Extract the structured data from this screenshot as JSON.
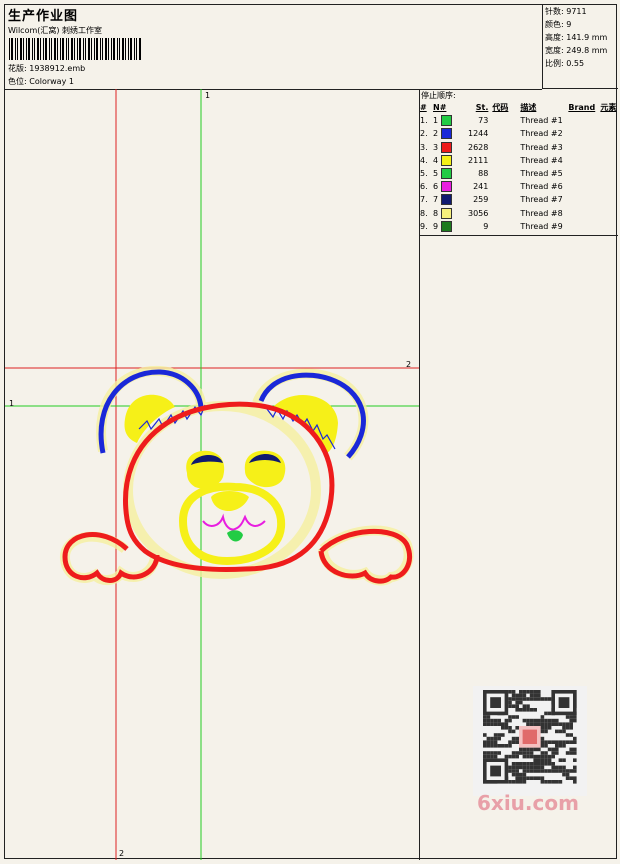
{
  "header": {
    "title": "生产作业图",
    "subtitle": "Wilcom(汇窝) 刺绣工作室",
    "design_label": "花版:",
    "design_value": "1938912.emb",
    "colorway_label": "色位:",
    "colorway_value": "Colorway 1"
  },
  "stats": [
    {
      "label": "针数:",
      "value": "9711"
    },
    {
      "label": "颜色:",
      "value": "9"
    },
    {
      "label": "高度:",
      "value": "141.9 mm"
    },
    {
      "label": "宽度:",
      "value": "249.8 mm"
    },
    {
      "label": "比例:",
      "value": "0.55"
    }
  ],
  "threads": {
    "title": "停止顺序:",
    "headers": [
      "#",
      "N#",
      "St.",
      "代码",
      "描述",
      "Brand",
      "元素"
    ],
    "rows": [
      {
        "num": "1.",
        "n": "1",
        "st": "73",
        "desc": "Thread #1",
        "color": "#22cc44"
      },
      {
        "num": "2.",
        "n": "2",
        "st": "1244",
        "desc": "Thread #2",
        "color": "#1a28d8"
      },
      {
        "num": "3.",
        "n": "3",
        "st": "2628",
        "desc": "Thread #3",
        "color": "#ee1c1c"
      },
      {
        "num": "4.",
        "n": "4",
        "st": "2111",
        "desc": "Thread #4",
        "color": "#f4f018"
      },
      {
        "num": "5.",
        "n": "5",
        "st": "88",
        "desc": "Thread #5",
        "color": "#22cc44"
      },
      {
        "num": "6.",
        "n": "6",
        "st": "241",
        "desc": "Thread #6",
        "color": "#e81ee0"
      },
      {
        "num": "7.",
        "n": "7",
        "st": "259",
        "desc": "Thread #7",
        "color": "#101a70"
      },
      {
        "num": "8.",
        "n": "8",
        "st": "3056",
        "desc": "Thread #8",
        "color": "#f6f07c"
      },
      {
        "num": "9.",
        "n": "9",
        "st": "9",
        "desc": "Thread #9",
        "color": "#1e7a1e"
      }
    ]
  },
  "guides": {
    "green": "1",
    "red": "2"
  },
  "watermark": "6xiu.com",
  "colors": {
    "red_guide": "#dd2222",
    "green_guide": "#22cc22"
  }
}
